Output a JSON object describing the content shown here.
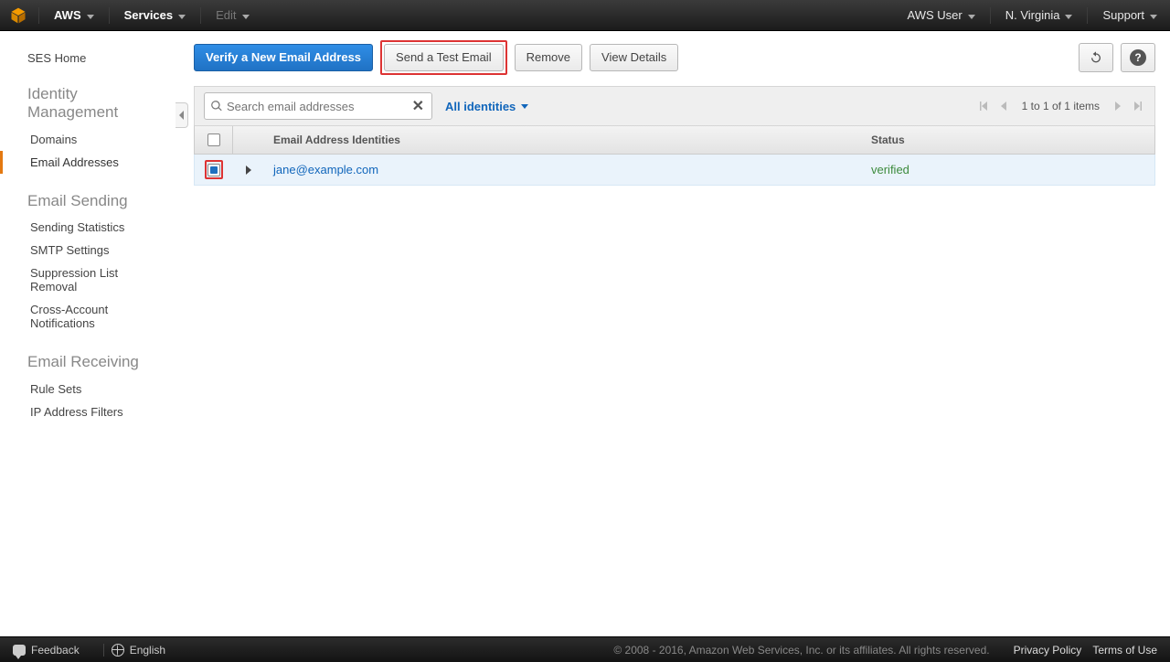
{
  "topbar": {
    "brand": "AWS",
    "services": "Services",
    "edit": "Edit",
    "user": "AWS User",
    "region": "N. Virginia",
    "support": "Support"
  },
  "sidebar": {
    "home": "SES Home",
    "sections": [
      {
        "title": "Identity Management",
        "items": [
          {
            "label": "Domains",
            "active": false
          },
          {
            "label": "Email Addresses",
            "active": true
          }
        ]
      },
      {
        "title": "Email Sending",
        "items": [
          {
            "label": "Sending Statistics"
          },
          {
            "label": "SMTP Settings"
          },
          {
            "label": "Suppression List Removal"
          },
          {
            "label": "Cross-Account Notifications"
          }
        ]
      },
      {
        "title": "Email Receiving",
        "items": [
          {
            "label": "Rule Sets"
          },
          {
            "label": "IP Address Filters"
          }
        ]
      }
    ]
  },
  "toolbar": {
    "verify": "Verify a New Email Address",
    "send_test": "Send a Test Email",
    "remove": "Remove",
    "view_details": "View Details"
  },
  "filter": {
    "placeholder": "Search email addresses",
    "clear_glyph": "✕",
    "all_identities": "All identities"
  },
  "pager": {
    "text": "1 to 1 of 1 items"
  },
  "table": {
    "col_email": "Email Address Identities",
    "col_status": "Status",
    "rows": [
      {
        "checked": true,
        "email": "jane@example.com",
        "status": "verified"
      }
    ]
  },
  "footer": {
    "feedback": "Feedback",
    "language": "English",
    "copyright": "© 2008 - 2016, Amazon Web Services, Inc. or its affiliates. All rights reserved.",
    "privacy": "Privacy Policy",
    "terms": "Terms of Use"
  }
}
